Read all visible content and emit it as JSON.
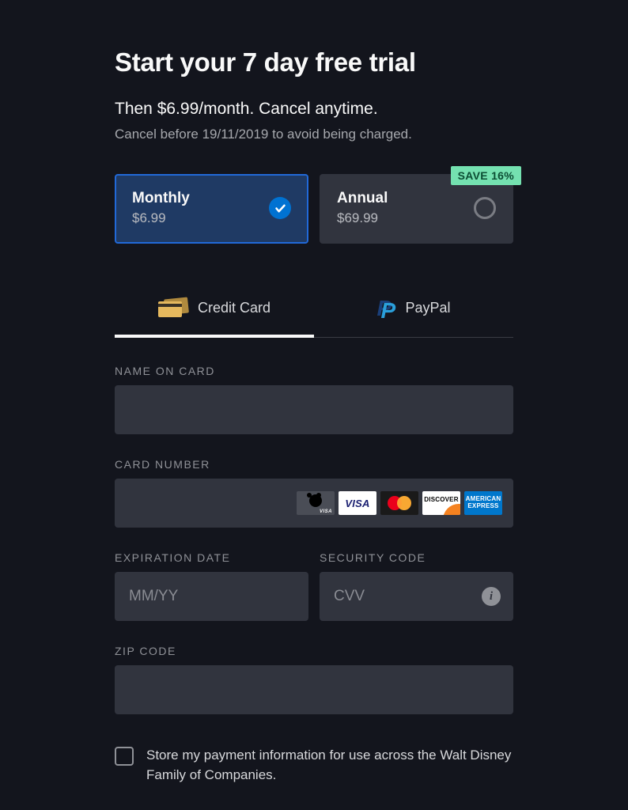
{
  "title": "Start your 7 day free trial",
  "subtitle": "Then $6.99/month. Cancel anytime.",
  "note": "Cancel before 19/11/2019 to avoid being charged.",
  "plans": {
    "monthly": {
      "name": "Monthly",
      "price": "$6.99"
    },
    "annual": {
      "name": "Annual",
      "price": "$69.99",
      "badge": "SAVE 16%"
    }
  },
  "tabs": {
    "credit_card": "Credit Card",
    "paypal": "PayPal"
  },
  "form": {
    "name_label": "NAME ON CARD",
    "card_label": "CARD NUMBER",
    "exp_label": "EXPIRATION DATE",
    "exp_placeholder": "MM/YY",
    "cvv_label": "SECURITY CODE",
    "cvv_placeholder": "CVV",
    "zip_label": "ZIP CODE",
    "card_brands": {
      "disney": "VISA",
      "visa": "VISA",
      "discover": "DISCOVER",
      "amex": "AMERICAN EXPRESS"
    }
  },
  "consent": "Store my payment information for use across the Walt Disney Family of Companies.",
  "info_glyph": "i"
}
